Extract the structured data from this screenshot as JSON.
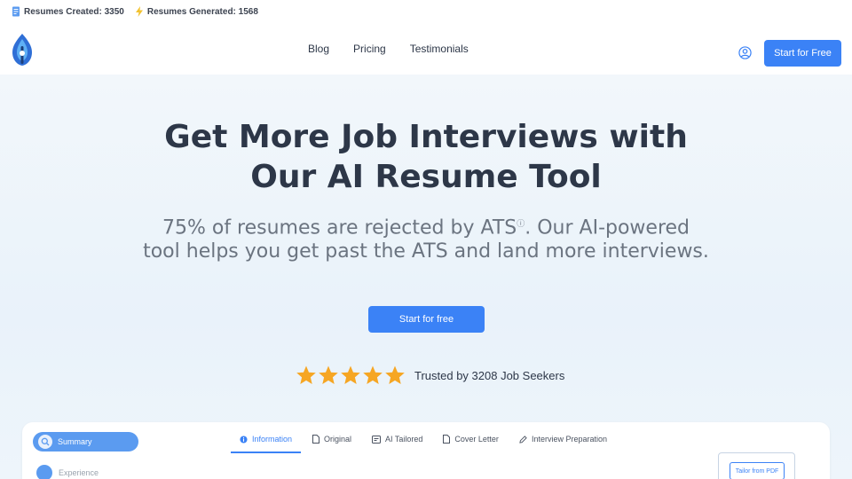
{
  "topbar": {
    "resumes_created": "Resumes Created: 3350",
    "resumes_generated": "Resumes Generated: 1568"
  },
  "nav": {
    "links": [
      "Blog",
      "Pricing",
      "Testimonials"
    ],
    "cta": "Start for Free"
  },
  "hero": {
    "headline_line1": "Get More Job Interviews with",
    "headline_line2": "Our AI Resume Tool",
    "subhead_part1": "75% of resumes are rejected by ATS",
    "subhead_part2": ". Our AI-powered tool helps you get past the ATS and land more interviews.",
    "cta": "Start for free",
    "trust_text": "Trusted by 3208 Job Seekers",
    "rating_stars": 5
  },
  "app_preview": {
    "sidebar": [
      "Summary",
      "Experience"
    ],
    "tabs": [
      "Information",
      "Original",
      "AI Tailored",
      "Cover Letter",
      "Interview Preparation"
    ],
    "tailor_button": "Tailor from PDF"
  },
  "colors": {
    "accent": "#3b82f6",
    "star": "#f6a623",
    "text_dark": "#2d3748",
    "text_muted": "#6b7480"
  },
  "icons": [
    "document-icon",
    "lightning-icon",
    "logo-icon",
    "user-icon",
    "star-icon",
    "search-icon",
    "info-icon",
    "file-icon",
    "ai-icon",
    "edit-icon"
  ]
}
